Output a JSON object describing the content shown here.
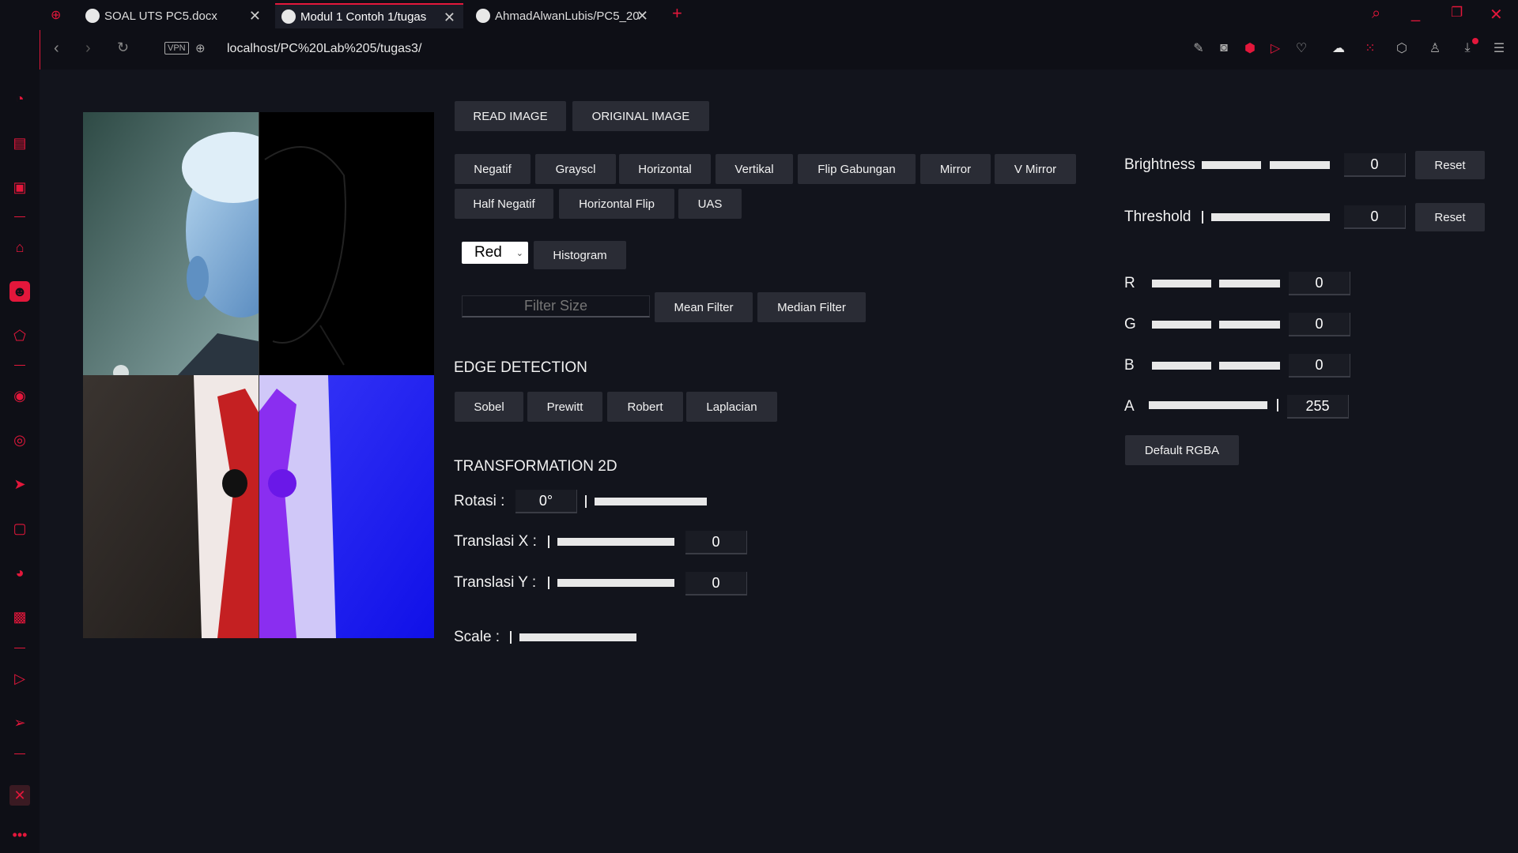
{
  "browser": {
    "tabs": [
      {
        "title": "SOAL UTS PC5.docx",
        "active": false
      },
      {
        "title": "Modul 1 Contoh 1/tugas",
        "active": true
      },
      {
        "title": "AhmadAlwanLubis/PC5_20",
        "active": false
      }
    ],
    "new_tab": "+",
    "vpn_label": "VPN",
    "url": "localhost/PC%20Lab%205/tugas3/",
    "accent": "#e3173b"
  },
  "top_buttons": {
    "read_image": "READ IMAGE",
    "original_image": "ORIGINAL IMAGE"
  },
  "filters_row1": [
    "Negatif",
    "Grayscl",
    "Horizontal",
    "Vertikal",
    "Flip Gabungan",
    "Mirror",
    "V Mirror"
  ],
  "filters_row2": [
    "Half Negatif",
    "Horizontal Flip",
    "UAS"
  ],
  "channel_select": {
    "value": "Red"
  },
  "histogram": "Histogram",
  "filter_size": {
    "placeholder": "Filter Size",
    "value": ""
  },
  "mean_filter": "Mean Filter",
  "median_filter": "Median Filter",
  "edge_detection": {
    "title": "EDGE DETECTION",
    "buttons": [
      "Sobel",
      "Prewitt",
      "Robert",
      "Laplacian"
    ]
  },
  "transformation": {
    "title": "TRANSFORMATION 2D",
    "rotasi_label": "Rotasi :",
    "rotasi_value": "0°",
    "translasi_x_label": "Translasi X :",
    "translasi_x_value": "0",
    "translasi_y_label": "Translasi Y :",
    "translasi_y_value": "0",
    "scale_label": "Scale :"
  },
  "adjust": {
    "brightness_label": "Brightness",
    "brightness_value": "0",
    "threshold_label": "Threshold",
    "threshold_value": "0",
    "reset": "Reset"
  },
  "rgba": {
    "r_label": "R",
    "r_value": "0",
    "g_label": "G",
    "g_value": "0",
    "b_label": "B",
    "b_value": "0",
    "a_label": "A",
    "a_value": "255",
    "default_button": "Default RGBA"
  }
}
